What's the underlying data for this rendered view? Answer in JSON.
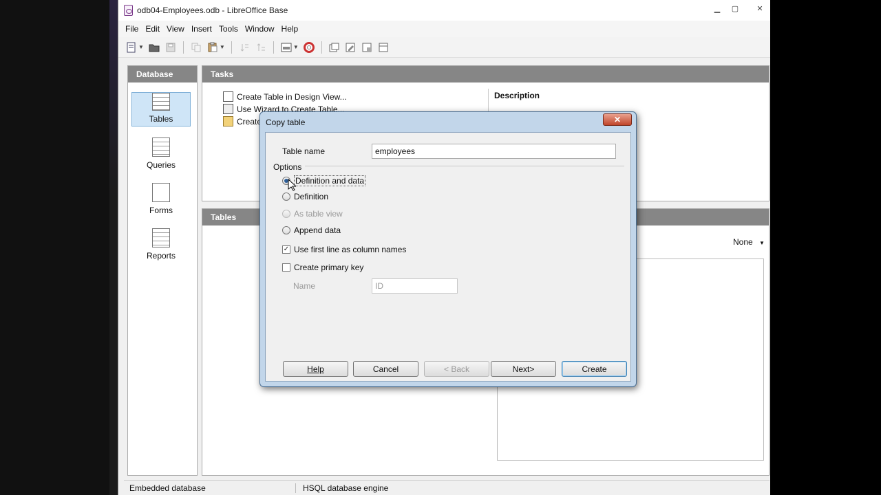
{
  "background": {
    "fragments": [
      "odb",
      "db",
      "lo"
    ]
  },
  "window": {
    "title": "odb04-Employees.odb - LibreOffice Base",
    "controls": {
      "minimize": "▁",
      "maximize": "▢",
      "close": "✕"
    }
  },
  "menu": [
    "File",
    "Edit",
    "View",
    "Insert",
    "Tools",
    "Window",
    "Help"
  ],
  "left_panel": {
    "header": "Database",
    "items": [
      {
        "label": "Tables",
        "selected": true
      },
      {
        "label": "Queries",
        "selected": false
      },
      {
        "label": "Forms",
        "selected": false
      },
      {
        "label": "Reports",
        "selected": false
      }
    ]
  },
  "tasks": {
    "header": "Tasks",
    "items": [
      "Create Table in Design View...",
      "Use Wizard to Create Table...",
      "Create"
    ],
    "description_label": "Description"
  },
  "tables_panel": {
    "header": "Tables",
    "preview_select": "None"
  },
  "status": {
    "left": "Embedded database",
    "right": "HSQL database engine"
  },
  "dialog": {
    "title": "Copy table",
    "close_label": "✕",
    "table_name_label": "Table name",
    "table_name_value": "employees",
    "options_label": "Options",
    "options": [
      {
        "label": "Definition and data",
        "selected": true,
        "enabled": true
      },
      {
        "label": "Definition",
        "selected": false,
        "enabled": true
      },
      {
        "label": "As table view",
        "selected": false,
        "enabled": false
      },
      {
        "label": "Append data",
        "selected": false,
        "enabled": true
      }
    ],
    "use_first_line": {
      "label": "Use first line as column names",
      "checked": true
    },
    "create_primary_key": {
      "label": "Create primary key",
      "checked": false
    },
    "name_label": "Name",
    "name_value": "ID",
    "buttons": {
      "help": "Help",
      "cancel": "Cancel",
      "back": "< Back",
      "next": "Next>",
      "create": "Create"
    }
  }
}
